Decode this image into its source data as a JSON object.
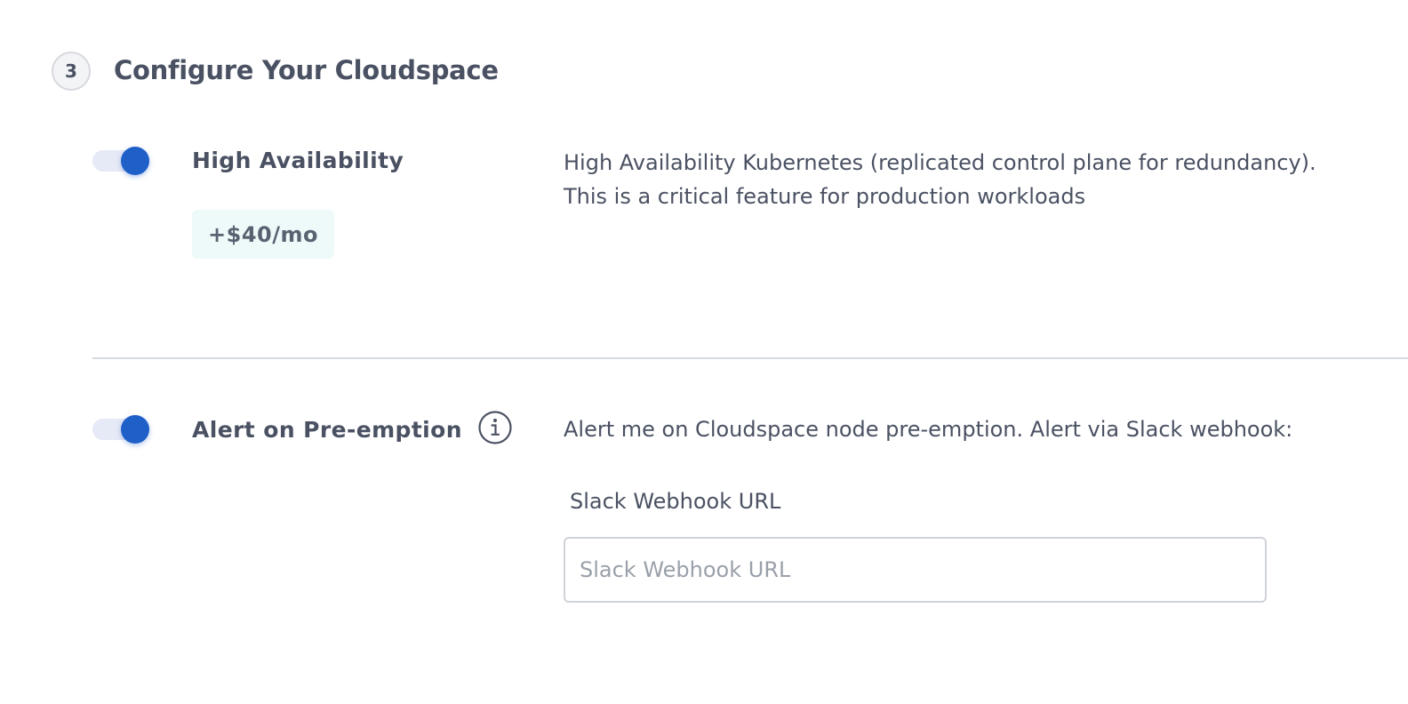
{
  "section": {
    "step_number": "3",
    "title": "Configure Your Cloudspace"
  },
  "options": [
    {
      "title": "High Availability",
      "enabled": true,
      "price": "+$40/mo",
      "description_lines": [
        "High Availability Kubernetes (replicated control plane for redundancy).",
        "This is a critical feature for production workloads"
      ]
    },
    {
      "title": "Alert on Pre-emption",
      "enabled": true,
      "info_icon": "info-circle-icon",
      "description_lines": [
        "Alert me on Cloudspace node pre-emption. Alert via Slack webhook:"
      ],
      "webhook": {
        "label": "Slack Webhook URL",
        "value": "",
        "placeholder": "Slack Webhook URL"
      }
    }
  ],
  "colors": {
    "accent": "#1f5fc8",
    "toggle_track": "#e6e9f6",
    "text": "#4a5162",
    "badge_bg": "#eefaf9",
    "divider": "#d6d9de"
  }
}
